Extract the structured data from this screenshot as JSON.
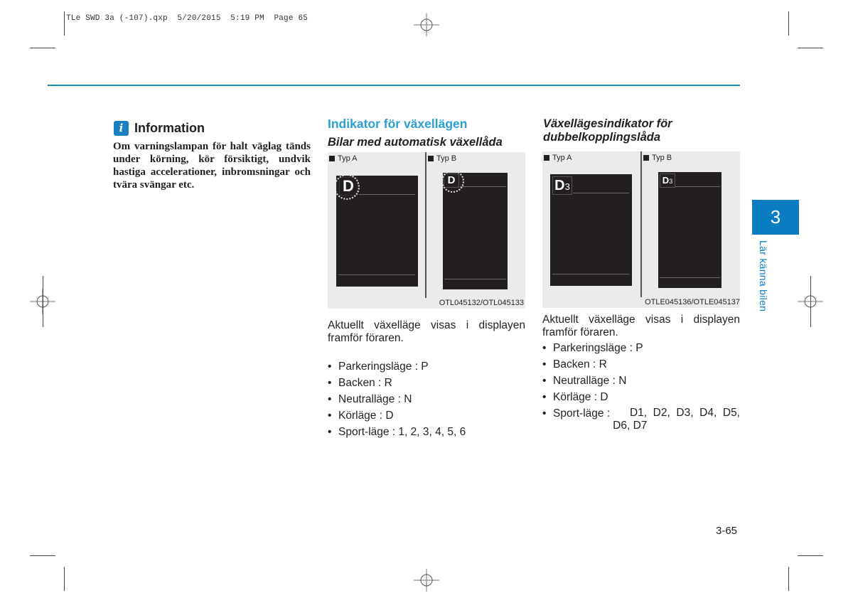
{
  "print_slug": "TLe SWD 3a (-107).qxp  5/20/2015  5:19 PM  Page 65",
  "info": {
    "icon": "info-icon",
    "icon_glyph": "i",
    "title": "Information",
    "body": "Om varningslampan för halt väglag tänds under körning, kör försiktigt, undvik hastiga accelerationer, inbromsningar och tvära svängar etc."
  },
  "section_automatic": {
    "title": "Indikator för växellägen",
    "subtitle": "Bilar med automatisk växellåda",
    "figure": {
      "type_a_label": "Typ A",
      "type_b_label": "Typ B",
      "type_a_gear": "D",
      "type_b_gear": "D",
      "code": "OTL045132/OTL045133"
    },
    "paragraph": "Aktuellt växelläge visas i displayen framför föraren.",
    "bullets": [
      "Parkeringsläge : P",
      "Backen : R",
      "Neutralläge : N",
      "Körläge : D",
      "Sport-läge : 1, 2, 3, 4, 5, 6"
    ]
  },
  "section_dct": {
    "subtitle_line1": "Växellägesindikator för",
    "subtitle_line2": "dubbelkopplingslåda",
    "figure": {
      "type_a_label": "Typ A",
      "type_b_label": "Typ B",
      "type_a_gear": "D",
      "type_a_gear_sub": "3",
      "type_b_gear": "D",
      "type_b_gear_sub": "3",
      "code": "OTLE045136/OTLE045137"
    },
    "paragraph": "Aktuellt växelläge visas i displayen framför föraren.",
    "bullets": [
      "Parkeringsläge : P",
      "Backen : R",
      "Neutralläge : N",
      "Körläge : D"
    ],
    "sport_label": "Sport-läge :",
    "sport_values_line1": "D1,  D2,  D3,  D4,  D5,",
    "sport_values_line2": "D6, D7"
  },
  "chapter": {
    "number": "3",
    "label": "Lär känna bilen",
    "color": "#0a7cc1"
  },
  "page_number": "3-65",
  "colors": {
    "rule": "#1a86a8",
    "heading": "#2aa0d0",
    "info_icon": "#1b7fc4"
  }
}
